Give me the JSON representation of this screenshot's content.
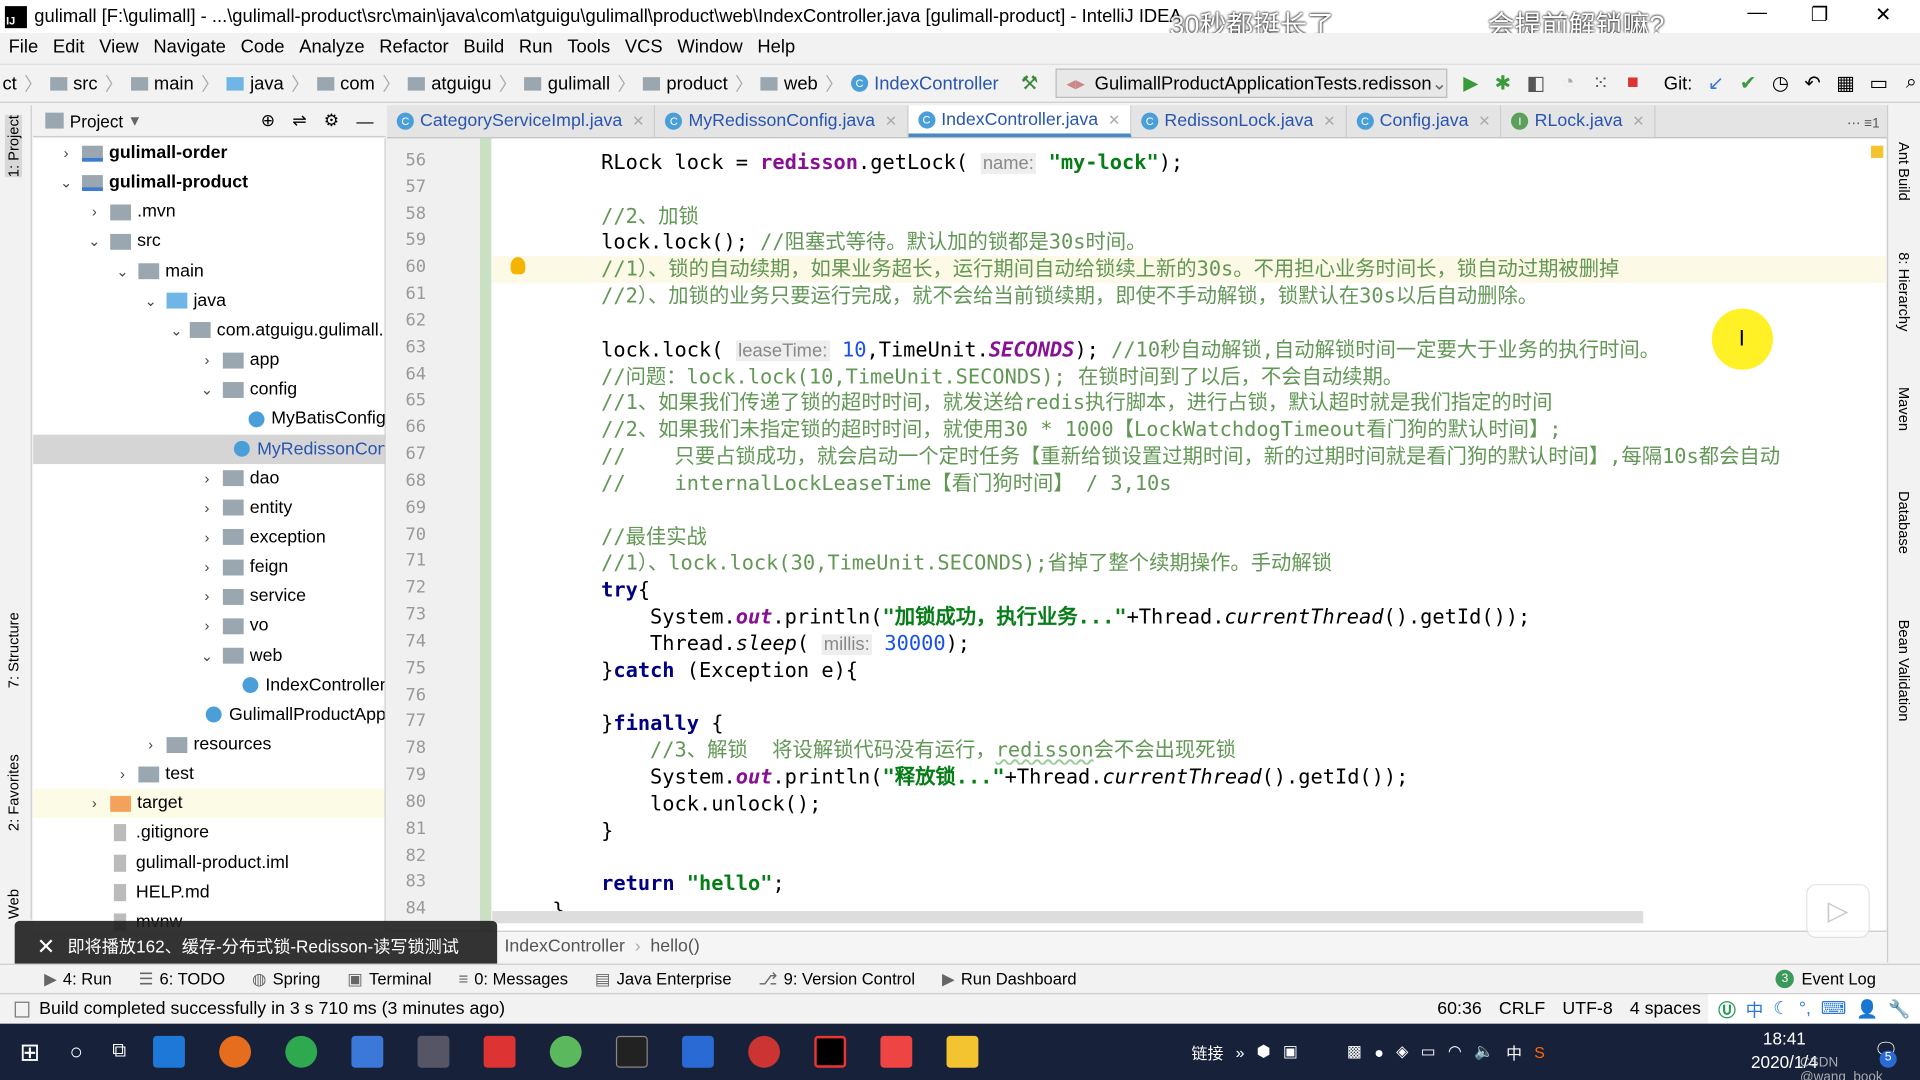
{
  "window": {
    "title": "gulimall [F:\\gulimall] - ...\\gulimall-product\\src\\main\\java\\com\\atguigu\\gulimall\\product\\web\\IndexController.java [gulimall-product] - IntelliJ IDEA",
    "logo": "IJ",
    "overlay_comments": [
      "30秒都挺长了",
      "会提前解锁嘛?"
    ]
  },
  "menu": [
    "File",
    "Edit",
    "View",
    "Navigate",
    "Code",
    "Analyze",
    "Refactor",
    "Build",
    "Run",
    "Tools",
    "VCS",
    "Window",
    "Help"
  ],
  "nav": {
    "crumbs": [
      "ct",
      "src",
      "main",
      "java",
      "com",
      "atguigu",
      "gulimall",
      "product",
      "web",
      "IndexController"
    ],
    "run_config": "GulimallProductApplicationTests.redisson",
    "git_label": "Git:"
  },
  "left_strip": [
    "1: Project",
    "7: Structure",
    "2: Favorites",
    "Web"
  ],
  "right_strip": [
    "Ant Build",
    "8: Hierarchy",
    "Maven",
    "Database",
    "Bean Validation"
  ],
  "project": {
    "header": "Project",
    "tree": [
      {
        "label": "gulimall-order",
        "level": 1,
        "arrow": "›",
        "icon": "module",
        "bold": true
      },
      {
        "label": "gulimall-product",
        "level": 1,
        "arrow": "⌄",
        "icon": "module",
        "bold": true
      },
      {
        "label": ".mvn",
        "level": 2,
        "arrow": "›",
        "icon": "folder"
      },
      {
        "label": "src",
        "level": 2,
        "arrow": "⌄",
        "icon": "folder"
      },
      {
        "label": "main",
        "level": 3,
        "arrow": "⌄",
        "icon": "folder"
      },
      {
        "label": "java",
        "level": 4,
        "arrow": "⌄",
        "icon": "blue"
      },
      {
        "label": "com.atguigu.gulimall.product",
        "level": 5,
        "arrow": "⌄",
        "icon": "folder"
      },
      {
        "label": "app",
        "level": 6,
        "arrow": "›",
        "icon": "folder"
      },
      {
        "label": "config",
        "level": 6,
        "arrow": "⌄",
        "icon": "folder"
      },
      {
        "label": "MyBatisConfig",
        "level": 7,
        "arrow": "",
        "icon": "class"
      },
      {
        "label": "MyRedissonConfig",
        "level": 7,
        "arrow": "",
        "icon": "class",
        "selected": true
      },
      {
        "label": "dao",
        "level": 6,
        "arrow": "›",
        "icon": "folder"
      },
      {
        "label": "entity",
        "level": 6,
        "arrow": "›",
        "icon": "folder"
      },
      {
        "label": "exception",
        "level": 6,
        "arrow": "›",
        "icon": "folder"
      },
      {
        "label": "feign",
        "level": 6,
        "arrow": "›",
        "icon": "folder"
      },
      {
        "label": "service",
        "level": 6,
        "arrow": "›",
        "icon": "folder"
      },
      {
        "label": "vo",
        "level": 6,
        "arrow": "›",
        "icon": "folder"
      },
      {
        "label": "web",
        "level": 6,
        "arrow": "⌄",
        "icon": "folder"
      },
      {
        "label": "IndexController",
        "level": 7,
        "arrow": "",
        "icon": "class"
      },
      {
        "label": "GulimallProductApplication",
        "level": 6,
        "arrow": "",
        "icon": "class"
      },
      {
        "label": "resources",
        "level": 4,
        "arrow": "›",
        "icon": "folder"
      },
      {
        "label": "test",
        "level": 3,
        "arrow": "›",
        "icon": "folder"
      },
      {
        "label": "target",
        "level": 2,
        "arrow": "›",
        "icon": "orange",
        "highlight": true
      },
      {
        "label": ".gitignore",
        "level": 2,
        "arrow": "",
        "icon": "file"
      },
      {
        "label": "gulimall-product.iml",
        "level": 2,
        "arrow": "",
        "icon": "file"
      },
      {
        "label": "HELP.md",
        "level": 2,
        "arrow": "",
        "icon": "file"
      },
      {
        "label": "mvnw",
        "level": 2,
        "arrow": "",
        "icon": "file"
      }
    ]
  },
  "tabs": [
    {
      "label": "CategoryServiceImpl.java",
      "active": false
    },
    {
      "label": "MyRedissonConfig.java",
      "active": false
    },
    {
      "label": "IndexController.java",
      "active": true
    },
    {
      "label": "RedissonLock.java",
      "active": false
    },
    {
      "label": "Config.java",
      "active": false
    },
    {
      "label": "RLock.java",
      "active": false
    }
  ],
  "editor": {
    "first_line": 56,
    "current_line": 60,
    "lines": [
      [
        [
          "        RLock lock = ",
          ""
        ],
        [
          "redisson",
          "mfld"
        ],
        [
          ".getLock( ",
          ""
        ],
        [
          "name:",
          "hint"
        ],
        [
          " ",
          ""
        ],
        [
          "\"my-lock\"",
          "str"
        ],
        [
          ");",
          ""
        ]
      ],
      [],
      [
        [
          "        //2、加锁",
          "cmz"
        ]
      ],
      [
        [
          "        lock.lock(); ",
          ""
        ],
        [
          "//阻塞式等待。默认加的锁都是30s时间。",
          "cmz"
        ]
      ],
      [
        [
          "        //1）、锁的自动续期，如果业务超长，运行期间自动给锁续上新的30s。不用担心业务时间长，锁自动过期被删掉",
          "cmz"
        ]
      ],
      [
        [
          "        //2）、加锁的业务只要运行完成，就不会给当前锁续期，即使不手动解锁，锁默认在30s以后自动删除。",
          "cmz"
        ]
      ],
      [],
      [
        [
          "        lock.lock( ",
          ""
        ],
        [
          "leaseTime:",
          "hint"
        ],
        [
          " ",
          ""
        ],
        [
          "10",
          "num"
        ],
        [
          ",TimeUnit.",
          ""
        ],
        [
          "SECONDS",
          "fld"
        ],
        [
          "); ",
          ""
        ],
        [
          "//10秒自动解锁,自动解锁时间一定要大于业务的执行时间。",
          "cmz"
        ]
      ],
      [
        [
          "        //问题：lock.lock(10,TimeUnit.SECONDS); 在锁时间到了以后，不会自动续期。",
          "cmz"
        ]
      ],
      [
        [
          "        //1、如果我们传递了锁的超时时间，就发送给redis执行脚本，进行占锁，默认超时就是我们指定的时间",
          "cmz"
        ]
      ],
      [
        [
          "        //2、如果我们未指定锁的超时时间，就使用30 * 1000【LockWatchdogTimeout看门狗的默认时间】;",
          "cmz"
        ]
      ],
      [
        [
          "        //    只要占锁成功，就会启动一个定时任务【重新给锁设置过期时间，新的过期时间就是看门狗的默认时间】,每隔10s都会自动",
          "cmz"
        ]
      ],
      [
        [
          "        //    internalLockLeaseTime【看门狗时间】 / 3,10s",
          "cmz"
        ]
      ],
      [],
      [
        [
          "        //最佳实战",
          "cmz"
        ]
      ],
      [
        [
          "        //1）、lock.lock(30,TimeUnit.SECONDS);省掉了整个续期操作。手动解锁",
          "cmz"
        ]
      ],
      [
        [
          "        ",
          ""
        ],
        [
          "try",
          "kw"
        ],
        [
          "{",
          ""
        ]
      ],
      [
        [
          "            System.",
          ""
        ],
        [
          "out",
          "fld"
        ],
        [
          ".println(",
          ""
        ],
        [
          "\"加锁成功，执行业务...\"",
          "str"
        ],
        [
          "+Thread.",
          ""
        ],
        [
          "currentThread",
          "it"
        ],
        [
          "().getId());",
          ""
        ]
      ],
      [
        [
          "            Thread.",
          ""
        ],
        [
          "sleep",
          "it"
        ],
        [
          "( ",
          ""
        ],
        [
          "millis:",
          "hint"
        ],
        [
          " ",
          ""
        ],
        [
          "30000",
          "num"
        ],
        [
          ");",
          ""
        ]
      ],
      [
        [
          "        }",
          ""
        ],
        [
          "catch",
          "kw"
        ],
        [
          " (Exception e){",
          ""
        ]
      ],
      [],
      [
        [
          "        }",
          ""
        ],
        [
          "finally",
          "kw"
        ],
        [
          " {",
          ""
        ]
      ],
      [
        [
          "            //3、解锁  将设解锁代码没有运行，",
          "cmz"
        ],
        [
          "redisson",
          "cmz wavy"
        ],
        [
          "会不会出现死锁",
          "cmz"
        ]
      ],
      [
        [
          "            System.",
          ""
        ],
        [
          "out",
          "fld"
        ],
        [
          ".println(",
          ""
        ],
        [
          "\"释放锁...\"",
          "str"
        ],
        [
          "+Thread.",
          ""
        ],
        [
          "currentThread",
          "it"
        ],
        [
          "().getId());",
          ""
        ]
      ],
      [
        [
          "            lock.unlock();",
          ""
        ]
      ],
      [
        [
          "        }",
          ""
        ]
      ],
      [],
      [
        [
          "        ",
          ""
        ],
        [
          "return",
          "kw"
        ],
        [
          " ",
          ""
        ],
        [
          "\"hello\"",
          "str"
        ],
        [
          ";",
          ""
        ]
      ],
      [
        [
          "    }",
          ""
        ]
      ]
    ]
  },
  "editor_breadcrumb": [
    "IndexController",
    "hello()"
  ],
  "toast": "即将播放162、缓存-分布式锁-Redisson-读写锁测试",
  "tool_tabs": [
    "4: Run",
    "6: TODO",
    "Spring",
    "Terminal",
    "0: Messages",
    "Java Enterprise",
    "9: Version Control",
    "Run Dashboard"
  ],
  "event_log": {
    "label": "Event Log",
    "count": "3"
  },
  "status": {
    "message": "Build completed successfully in 3 s 710 ms (3 minutes ago)",
    "position": "60:36",
    "line_sep": "CRLF",
    "encoding": "UTF-8",
    "indent": "4 spaces",
    "ime": "中"
  },
  "taskbar": {
    "tray_text": "链接",
    "ime": "中",
    "time": "18:41",
    "date": "2020/1/4",
    "notifications": "5",
    "watermark": "CSDN @wang_book"
  },
  "colors": {
    "accent": "#4a88c7",
    "comment": "#629755",
    "keyword": "#000080",
    "string": "#067d17",
    "taskbar": "#17223a"
  }
}
